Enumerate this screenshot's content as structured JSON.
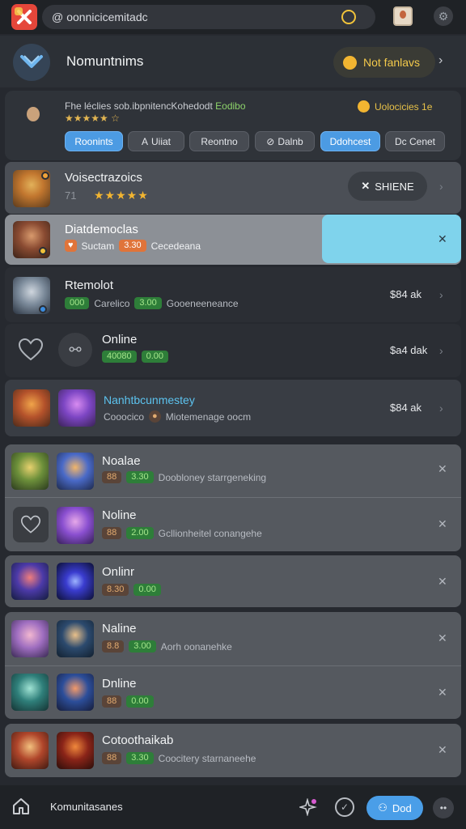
{
  "browser": {
    "url_prefix": "@",
    "url": "oonnicicemitadc"
  },
  "header": {
    "title": "Nomuntnims",
    "filter_label": "Not fanlavs"
  },
  "featured": {
    "line1_a": "Fhe léclies sob.ibpnitencKohedodt",
    "line1_b": "Eodibo",
    "line2": "★★★★★ ☆",
    "badge": "Uolocicies 1e",
    "chips": [
      "Roonints",
      "Uiiat",
      "Reontno",
      "Dalnb",
      "Ddohcest",
      "Dc Cenet"
    ]
  },
  "rows": [
    {
      "title": "Voisectrazoics",
      "rating_prefix": "71",
      "stars": "★★★★★",
      "action": "SHIENE"
    },
    {
      "title": "Diatdemoclas",
      "label": "Suctam",
      "tag": "3.30",
      "desc": "Cecedeana"
    },
    {
      "title": "Rtemolot",
      "tag1": "000",
      "label": "Carelico",
      "tag2": "3.00",
      "desc": "Gooeneeneance",
      "price": "$84 ak"
    },
    {
      "title": "Online",
      "tag1": "40080",
      "tag2": "0.00",
      "price": "$a4 dak"
    },
    {
      "title": "Nanhtbcunmestey",
      "label": "Cooocico",
      "desc": "Miotemenage oocm",
      "price": "$84 ak"
    }
  ],
  "group1": [
    {
      "title": "Noalae",
      "tag1": "88",
      "tag2": "3.30",
      "desc": "Doobloney starrgeneking"
    },
    {
      "title": "Noline",
      "tag1": "88",
      "tag2": "2.00",
      "desc": "Gcllionheitel conangehe"
    }
  ],
  "group2": [
    {
      "title": "Onlinr",
      "tag1": "8.30",
      "tag2": "0.00"
    }
  ],
  "group3": [
    {
      "title": "Naline",
      "tag1": "8.8",
      "tag2": "3.00",
      "desc": "Aorh oonanehke"
    },
    {
      "title": "Dnline",
      "tag1": "88",
      "tag2": "0.00"
    }
  ],
  "group4": [
    {
      "title": "Cotoothaikab",
      "tag1": "88",
      "tag2": "3.30",
      "desc": "Coocitery starnaneehe"
    }
  ],
  "bottom": {
    "title": "Komunitasanes",
    "cta": "Dod"
  },
  "colors": {
    "accent_blue": "#4c9be3",
    "highlight_cyan": "#7fd3ec",
    "tag_orange": "#e0743a",
    "tag_green": "#3a9441",
    "star_yellow": "#f2b531"
  }
}
